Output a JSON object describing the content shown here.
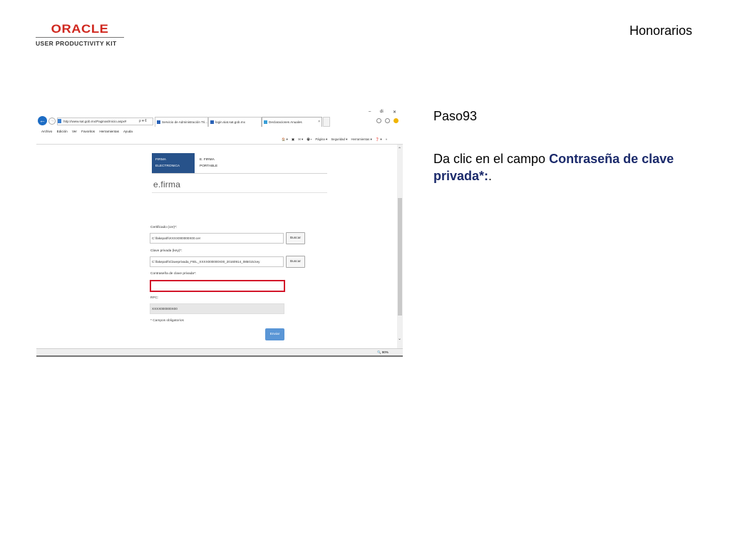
{
  "logo": {
    "word": "ORACLE",
    "sub": "USER PRODUCTIVITY KIT"
  },
  "section_title": "Honorarios",
  "step_label": "Paso93",
  "instruction": {
    "prefix": "Da clic en el campo ",
    "field": "Contraseña de clave privada*:",
    "suffix": "."
  },
  "browser": {
    "address": "http://www.sat.gob.mx/Paginas/Inicio.aspx#",
    "address_ctrl": "ρ ▾ ¢",
    "tabs": [
      {
        "label": "Servicio de Administración Tri..."
      },
      {
        "label": "login.siat.sat.gob.mx"
      },
      {
        "label": "Declaraciones Anuales"
      }
    ],
    "win_min": "–",
    "win_max": "di",
    "win_close": "✕",
    "menu": [
      "Archivo",
      "Edición",
      "Ver",
      "Favoritos",
      "Herramientas",
      "Ayuda"
    ],
    "command_bar": [
      "🏠 ▾",
      "▣",
      "✉ ▾",
      "🖶 ▾",
      "Página ▾",
      "Seguridad ▾",
      "Herramientas ▾",
      "❓ ▾",
      "»"
    ],
    "zoom": "🔍 90%",
    "scroll_up": "⌃",
    "scroll_down": "⌄"
  },
  "form": {
    "header_left": [
      "FIRMA",
      "ELECTRONICA"
    ],
    "header_right": [
      "E. FIRMA",
      "PORTABLE"
    ],
    "title": "e.firma",
    "cert_label": "Certificado (cer)*:",
    "cert_value": "C:\\fakepath\\XXXX000000X00.cer",
    "key_label": "Clave privada (key)*:",
    "key_value": "C:\\fakepath\\Claveprivada_FIEL_XXXX000000X00_20160914_085015.key",
    "browse_label": "Buscar",
    "password_label": "Contraseña de clave privada*:",
    "password_value": "",
    "rfc_label": "RFC:",
    "rfc_value": "XXXX000000X00",
    "required_note": "* Campos obligatorios",
    "send_label": "Enviar"
  },
  "colors": {
    "highlight": "#d3162a",
    "brand_red": "#d0281f",
    "header_blue": "#27528a",
    "button_blue": "#5a96d6",
    "instruction_field": "#1b2a6b"
  }
}
